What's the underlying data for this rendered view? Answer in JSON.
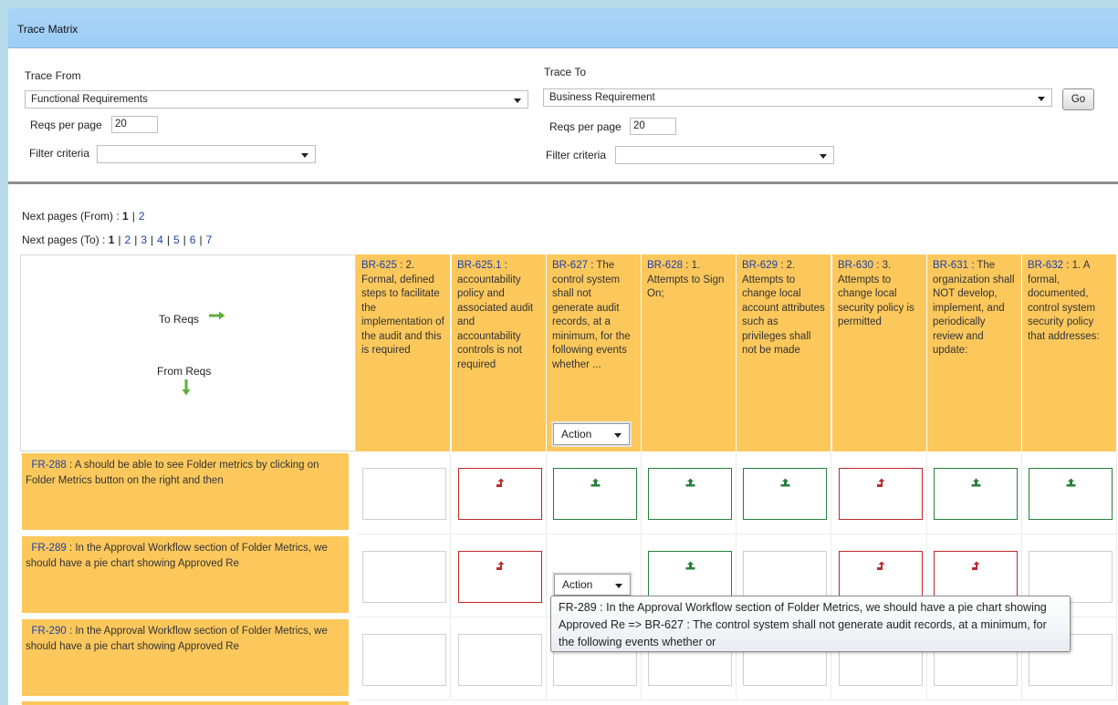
{
  "window": {
    "title": "Trace Matrix"
  },
  "trace_from": {
    "label": "Trace From",
    "selected": "Functional Requirements",
    "reqs_label": "Reqs per page",
    "reqs_value": "20",
    "filter_label": "Filter criteria",
    "filter_value": ""
  },
  "trace_to": {
    "label": "Trace To",
    "selected": "Business Requirement",
    "reqs_label": "Reqs per page",
    "reqs_value": "20",
    "filter_label": "Filter criteria",
    "filter_value": "",
    "go_label": "Go"
  },
  "pager_from": {
    "label": "Next pages (From) :",
    "current": "1",
    "pages": [
      "2"
    ]
  },
  "pager_to": {
    "label": "Next pages (To) :",
    "current": "1",
    "pages": [
      "2",
      "3",
      "4",
      "5",
      "6",
      "7"
    ]
  },
  "corner": {
    "to_label": "To Reqs",
    "from_label": "From Reqs"
  },
  "columns": [
    {
      "id": "BR-625",
      "text": " : 2. Formal, defined steps to facilitate the implementation of the audit and this is required"
    },
    {
      "id": "BR-625.1",
      "text": " : accountability policy and associated audit and accountability controls is not required"
    },
    {
      "id": "BR-627",
      "text": " : The control system shall not generate audit records, at a minimum, for the following events whether ..."
    },
    {
      "id": "BR-628",
      "text": " : 1. Attempts to Sign On;"
    },
    {
      "id": "BR-629",
      "text": " : 2. Attempts to change local account attributes such as privileges shall not be made"
    },
    {
      "id": "BR-630",
      "text": " : 3.   Attempts to change local security policy is permitted"
    },
    {
      "id": "BR-631",
      "text": " : The organization shall NOT develop, implement, and periodically review and update:"
    },
    {
      "id": "BR-632",
      "text": " : 1. A formal, documented, control system security policy that addresses:"
    }
  ],
  "action_label": "Action",
  "rows": [
    {
      "id": "FR-288",
      "text": " : A should be able to see Folder metrics by clicking on Folder Metrics button on the right and then",
      "cells": [
        "empty",
        "red",
        "green",
        "green",
        "green",
        "red",
        "green",
        "green"
      ]
    },
    {
      "id": "FR-289",
      "text": " : In the Approval Workflow section of Folder Metrics, we should have a pie chart showing Approved Re",
      "cells": [
        "empty",
        "red",
        "action",
        "green",
        "empty",
        "red",
        "red",
        "empty"
      ]
    },
    {
      "id": "FR-290",
      "text": " : In the Approval Workflow section of Folder Metrics, we should have a pie chart showing Approved Re",
      "cells": [
        "empty",
        "empty",
        "empty",
        "empty",
        "empty",
        "empty",
        "empty",
        "empty"
      ]
    }
  ],
  "tooltip": "FR-289 : In the Approval Workflow section of Folder Metrics, we should have a pie chart showing Approved Re => BR-627 : The control system shall not generate audit records, at a minimum, for the following events whether or",
  "colors": {
    "header_bg": "#fcc85c",
    "titlebar_bg": "#9ccdf6",
    "traced_red": "#c0282a",
    "traced_green": "#26803a",
    "link": "#1d3fa6"
  }
}
